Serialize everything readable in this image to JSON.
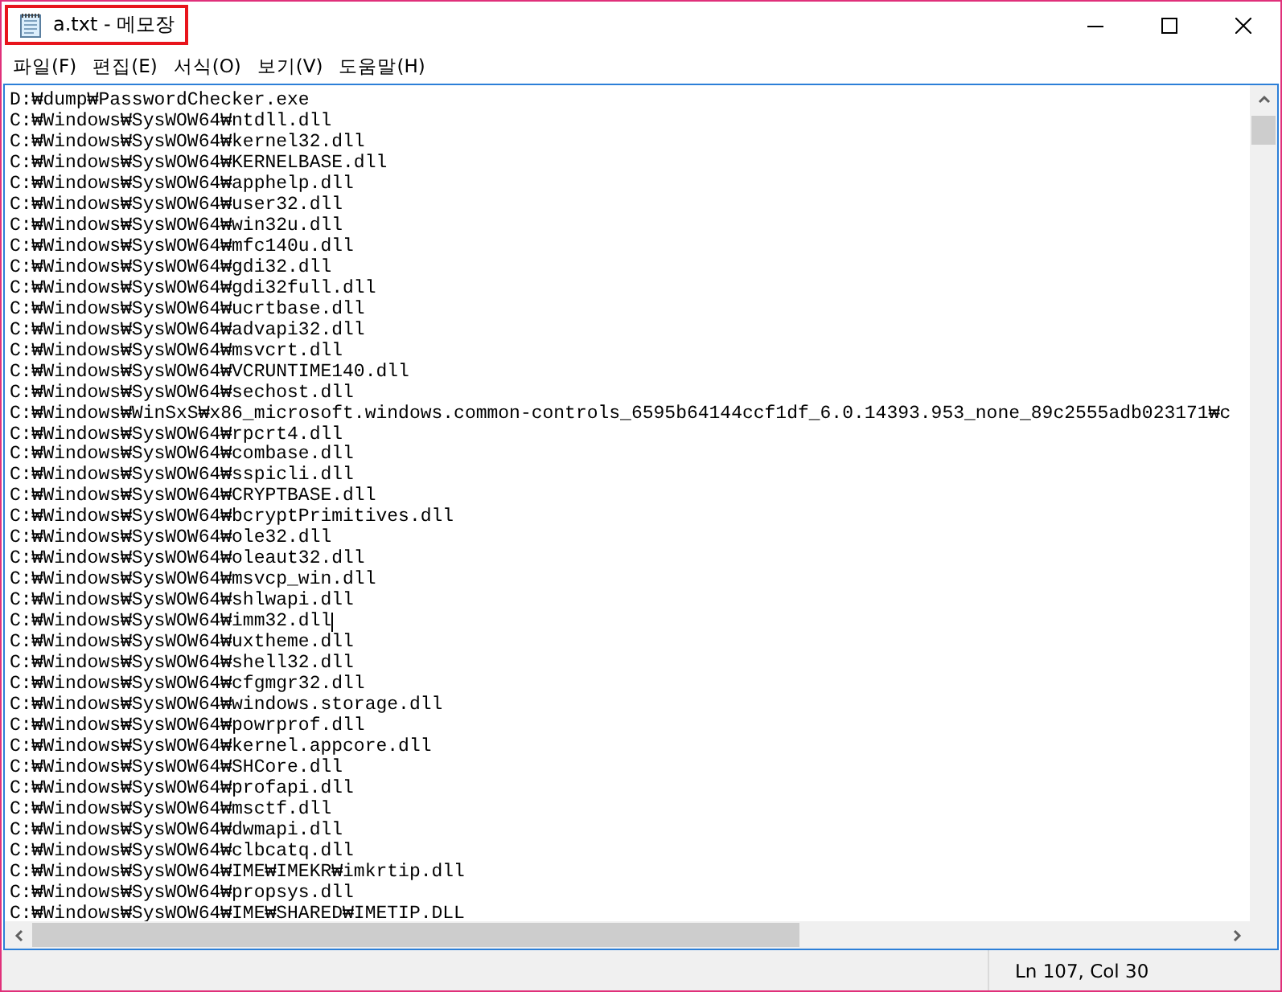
{
  "window": {
    "title": "a.txt - 메모장"
  },
  "menu": [
    "파일(F)",
    "편집(E)",
    "서식(O)",
    "보기(V)",
    "도움말(H)"
  ],
  "lines": [
    {
      "text": "D:₩dump₩PasswordChecker.exe",
      "cursor": false
    },
    {
      "text": "C:₩Windows₩SysWOW64₩ntdll.dll",
      "cursor": false
    },
    {
      "text": "C:₩Windows₩SysWOW64₩kernel32.dll",
      "cursor": false
    },
    {
      "text": "C:₩Windows₩SysWOW64₩KERNELBASE.dll",
      "cursor": false
    },
    {
      "text": "C:₩Windows₩SysWOW64₩apphelp.dll",
      "cursor": false
    },
    {
      "text": "C:₩Windows₩SysWOW64₩user32.dll",
      "cursor": false
    },
    {
      "text": "C:₩Windows₩SysWOW64₩win32u.dll",
      "cursor": false
    },
    {
      "text": "C:₩Windows₩SysWOW64₩mfc140u.dll",
      "cursor": false
    },
    {
      "text": "C:₩Windows₩SysWOW64₩gdi32.dll",
      "cursor": false
    },
    {
      "text": "C:₩Windows₩SysWOW64₩gdi32full.dll",
      "cursor": false
    },
    {
      "text": "C:₩Windows₩SysWOW64₩ucrtbase.dll",
      "cursor": false
    },
    {
      "text": "C:₩Windows₩SysWOW64₩advapi32.dll",
      "cursor": false
    },
    {
      "text": "C:₩Windows₩SysWOW64₩msvcrt.dll",
      "cursor": false
    },
    {
      "text": "C:₩Windows₩SysWOW64₩VCRUNTIME140.dll",
      "cursor": false
    },
    {
      "text": "C:₩Windows₩SysWOW64₩sechost.dll",
      "cursor": false
    },
    {
      "text": "C:₩Windows₩WinSxS₩x86_microsoft.windows.common-controls_6595b64144ccf1df_6.0.14393.953_none_89c2555adb023171₩c",
      "cursor": false
    },
    {
      "text": "C:₩Windows₩SysWOW64₩rpcrt4.dll",
      "cursor": false
    },
    {
      "text": "C:₩Windows₩SysWOW64₩combase.dll",
      "cursor": false
    },
    {
      "text": "C:₩Windows₩SysWOW64₩sspicli.dll",
      "cursor": false
    },
    {
      "text": "C:₩Windows₩SysWOW64₩CRYPTBASE.dll",
      "cursor": false
    },
    {
      "text": "C:₩Windows₩SysWOW64₩bcryptPrimitives.dll",
      "cursor": false
    },
    {
      "text": "C:₩Windows₩SysWOW64₩ole32.dll",
      "cursor": false
    },
    {
      "text": "C:₩Windows₩SysWOW64₩oleaut32.dll",
      "cursor": false
    },
    {
      "text": "C:₩Windows₩SysWOW64₩msvcp_win.dll",
      "cursor": false
    },
    {
      "text": "C:₩Windows₩SysWOW64₩shlwapi.dll",
      "cursor": false
    },
    {
      "text": "C:₩Windows₩SysWOW64₩imm32.dll",
      "cursor": true
    },
    {
      "text": "C:₩Windows₩SysWOW64₩uxtheme.dll",
      "cursor": false
    },
    {
      "text": "C:₩Windows₩SysWOW64₩shell32.dll",
      "cursor": false
    },
    {
      "text": "C:₩Windows₩SysWOW64₩cfgmgr32.dll",
      "cursor": false
    },
    {
      "text": "C:₩Windows₩SysWOW64₩windows.storage.dll",
      "cursor": false
    },
    {
      "text": "C:₩Windows₩SysWOW64₩powrprof.dll",
      "cursor": false
    },
    {
      "text": "C:₩Windows₩SysWOW64₩kernel.appcore.dll",
      "cursor": false
    },
    {
      "text": "C:₩Windows₩SysWOW64₩SHCore.dll",
      "cursor": false
    },
    {
      "text": "C:₩Windows₩SysWOW64₩profapi.dll",
      "cursor": false
    },
    {
      "text": "C:₩Windows₩SysWOW64₩msctf.dll",
      "cursor": false
    },
    {
      "text": "C:₩Windows₩SysWOW64₩dwmapi.dll",
      "cursor": false
    },
    {
      "text": "C:₩Windows₩SysWOW64₩clbcatq.dll",
      "cursor": false
    },
    {
      "text": "C:₩Windows₩SysWOW64₩IME₩IMEKR₩imkrtip.dll",
      "cursor": false
    },
    {
      "text": "C:₩Windows₩SysWOW64₩propsys.dll",
      "cursor": false
    },
    {
      "text": "C:₩Windows₩SysWOW64₩IME₩SHARED₩IMETIP.DLL",
      "cursor": false
    }
  ],
  "status_bar": {
    "position": "Ln 107, Col 30"
  }
}
